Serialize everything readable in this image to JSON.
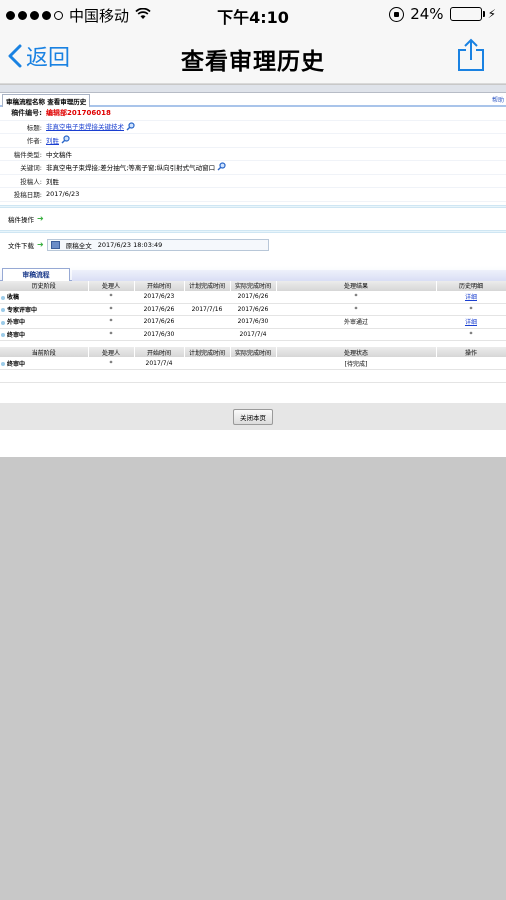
{
  "status_bar": {
    "carrier": "中国移动",
    "time": "下午4:10",
    "battery": "24%",
    "battery_level": 0.24,
    "battery_color": "#4cd964"
  },
  "nav": {
    "back_label": "返回",
    "title": "查看审理历史",
    "accent": "#1a82e2",
    "share_icon": "share-icon"
  },
  "page": {
    "tab_title": "审稿流程名称 查看审理历史",
    "help_link": "帮助",
    "fields": {
      "number_label": "稿件编号:",
      "number_value": "编辑部201706018",
      "title_label": "标题:",
      "title_value": "非真空电子束焊接关键技术",
      "author_label": "作者:",
      "author_value": "刘胜",
      "type_label": "稿件类型:",
      "type_value": "中文稿件",
      "keywords_label": "关键词:",
      "keywords_value": "非真空电子束焊接;差分抽气;等离子窗;纵向引射式气动窗口",
      "submitter_label": "投稿人:",
      "submitter_value": "刘胜",
      "date_label": "投稿日期:",
      "date_value": "2017/6/23"
    },
    "operation_label": "稿件操作",
    "download_label": "文件下载",
    "download_file": "原稿全文",
    "download_time": "2017/6/23 18:03:49",
    "process_tab": "审稿流程",
    "history_table": {
      "headers": [
        "历史阶段",
        "处理人",
        "开始时间",
        "计划完成时间",
        "实际完成时间",
        "处理结果",
        "历史明细"
      ],
      "rows": [
        {
          "stage": "收稿",
          "handler": "*",
          "start": "2017/6/23",
          "plan": "",
          "actual": "2017/6/26",
          "result": "*",
          "detail": "详细"
        },
        {
          "stage": "专家评审中",
          "handler": "*",
          "start": "2017/6/26",
          "plan": "2017/7/16",
          "actual": "2017/6/26",
          "result": "*",
          "detail": "*"
        },
        {
          "stage": "外审中",
          "handler": "*",
          "start": "2017/6/26",
          "plan": "",
          "actual": "2017/6/30",
          "result": "外审通过",
          "detail": "详细"
        },
        {
          "stage": "终审中",
          "handler": "*",
          "start": "2017/6/30",
          "plan": "",
          "actual": "2017/7/4",
          "result": "",
          "detail": "*"
        }
      ]
    },
    "current_table": {
      "headers": [
        "当前阶段",
        "处理人",
        "开始时间",
        "计划完成时间",
        "实际完成时间",
        "处理状态",
        "操作"
      ],
      "rows": [
        {
          "stage": "终审中",
          "handler": "*",
          "start": "2017/7/4",
          "plan": "",
          "actual": "",
          "status": "[待完成]",
          "op": ""
        }
      ]
    },
    "close_button": "关闭本页"
  }
}
